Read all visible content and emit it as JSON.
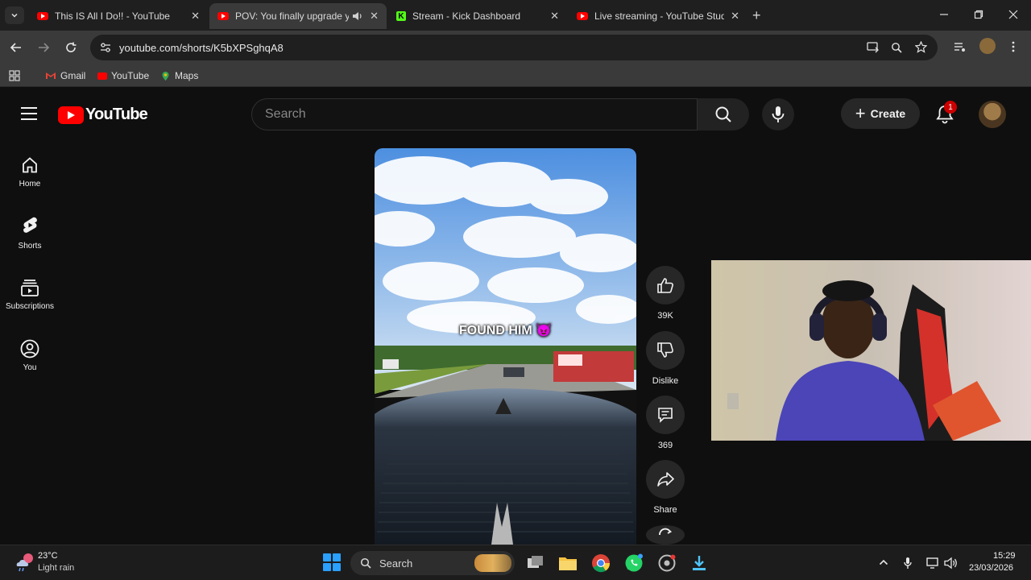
{
  "browser": {
    "tabs": [
      {
        "title": "This IS All I Do!! - YouTube",
        "favicon": "youtube-icon",
        "active": false
      },
      {
        "title": "POV: You finally upgrade yo",
        "favicon": "youtube-icon",
        "active": true,
        "audio": "speaker-icon"
      },
      {
        "title": "Stream - Kick Dashboard",
        "favicon": "kick-icon",
        "active": false
      },
      {
        "title": "Live streaming - YouTube Studio",
        "favicon": "youtube-icon",
        "active": false
      }
    ],
    "kick_glyph": "K",
    "new_tab_glyph": "+",
    "close_glyph": "✕",
    "url": "youtube.com/shorts/K5bXPSghqA8",
    "bookmarks": [
      {
        "label": "Gmail",
        "icon": "gmail-icon",
        "color": "#ea4335"
      },
      {
        "label": "YouTube",
        "icon": "youtube-icon",
        "color": "#ff0000"
      },
      {
        "label": "Maps",
        "icon": "maps-icon",
        "color": "#34a853"
      }
    ]
  },
  "youtube": {
    "logo_text": "YouTube",
    "search_placeholder": "Search",
    "create_label": "Create",
    "notification_count": "1",
    "guide": [
      {
        "label": "Home",
        "icon": "home-icon"
      },
      {
        "label": "Shorts",
        "icon": "shorts-icon"
      },
      {
        "label": "Subscriptions",
        "icon": "subscriptions-icon"
      },
      {
        "label": "You",
        "icon": "account-icon"
      }
    ],
    "short": {
      "caption": "FOUND HIM 😈",
      "likes": "39K",
      "dislike_label": "Dislike",
      "comments": "369",
      "share_label": "Share"
    }
  },
  "taskbar": {
    "weather_temp": "23°C",
    "weather_desc": "Light rain",
    "search_label": "Search",
    "time": "15:29",
    "date": "23/03/2026"
  },
  "colors": {
    "youtube_red": "#ff0000",
    "page_bg": "#0f0f0f",
    "chrome_bg": "#1f1f1f",
    "kick_green": "#53fc18"
  }
}
